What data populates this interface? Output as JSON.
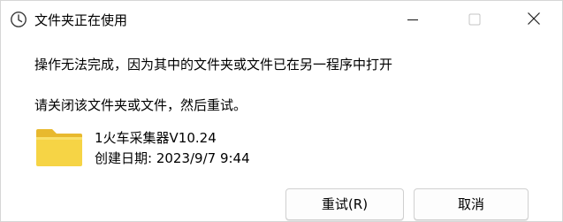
{
  "window": {
    "title": "文件夹正在使用"
  },
  "message": {
    "line1": "操作无法完成，因为其中的文件夹或文件已在另一程序中打开",
    "line2": "请关闭该文件夹或文件，然后重试。"
  },
  "file": {
    "name": "1火车采集器V10.24",
    "created": "创建日期: 2023/9/7 9:44"
  },
  "buttons": {
    "retry": "重试(R)",
    "cancel": "取消"
  },
  "icons": {
    "title": "clock-icon",
    "folder": "folder-icon",
    "minimize": "minimize-icon",
    "maximize": "maximize-icon",
    "close": "close-icon"
  },
  "colors": {
    "folder_body": "#f6d445",
    "folder_tab": "#e8b92e",
    "border": "#d0d0d0"
  }
}
